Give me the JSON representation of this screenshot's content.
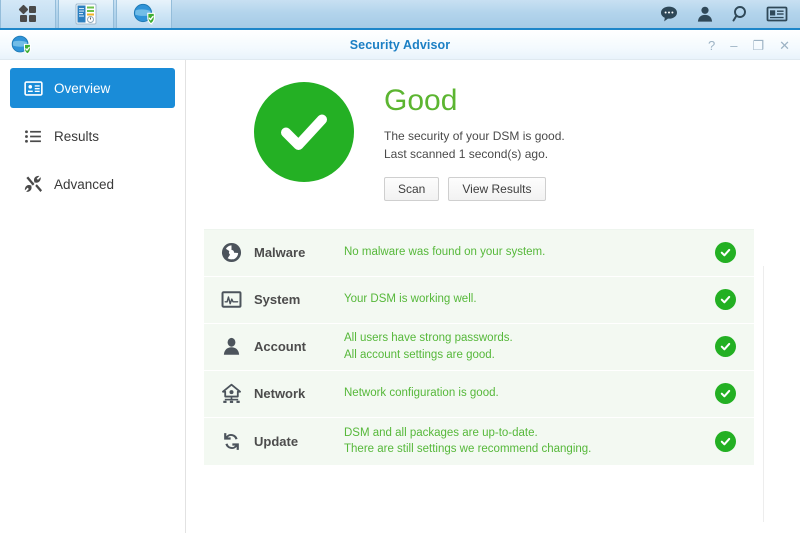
{
  "taskbar": {
    "apps": [
      {
        "name": "package-center-icon",
        "label": "Package Center"
      },
      {
        "name": "control-panel-icon",
        "label": "Control Panel"
      },
      {
        "name": "security-advisor-icon",
        "label": "Security Advisor"
      }
    ],
    "tray": [
      {
        "name": "notifications-icon",
        "label": "Notifications"
      },
      {
        "name": "user-account-icon",
        "label": "Options"
      },
      {
        "name": "search-icon",
        "label": "Search"
      },
      {
        "name": "widgets-icon",
        "label": "Widgets"
      }
    ]
  },
  "window": {
    "title": "Security Advisor",
    "app_icon": "security-advisor-icon",
    "controls": {
      "help": "?",
      "minimize": "–",
      "maximize": "❐",
      "close": "✕"
    }
  },
  "sidebar": {
    "items": [
      {
        "label": "Overview",
        "icon": "overview-icon",
        "active": true
      },
      {
        "label": "Results",
        "icon": "list-icon",
        "active": false
      },
      {
        "label": "Advanced",
        "icon": "tools-icon",
        "active": false
      }
    ]
  },
  "summary": {
    "status_icon": "check-circle-icon",
    "status_title": "Good",
    "description": "The security of your DSM is good.",
    "last_scanned": "Last scanned 1 second(s) ago.",
    "buttons": {
      "scan": "Scan",
      "view_results": "View Results"
    }
  },
  "results": [
    {
      "icon": "malware-icon",
      "name": "Malware",
      "lines": [
        "No malware was found on your system."
      ],
      "status": "ok"
    },
    {
      "icon": "system-monitor-icon",
      "name": "System",
      "lines": [
        "Your DSM is working well."
      ],
      "status": "ok"
    },
    {
      "icon": "account-icon",
      "name": "Account",
      "lines": [
        "All users have strong passwords.",
        "All account settings are good."
      ],
      "status": "ok"
    },
    {
      "icon": "network-icon",
      "name": "Network",
      "lines": [
        "Network configuration is good."
      ],
      "status": "ok"
    },
    {
      "icon": "update-icon",
      "name": "Update",
      "lines": [
        "DSM and all packages are up-to-date.",
        "There are still settings we recommend changing."
      ],
      "status": "ok"
    }
  ],
  "colors": {
    "accent_blue": "#1a8cd8",
    "title_blue": "#1b7fc4",
    "good_green": "#24b024",
    "text_green": "#56b83a",
    "heading_green": "#5cb531",
    "row_bg": "#f3f9f2"
  }
}
